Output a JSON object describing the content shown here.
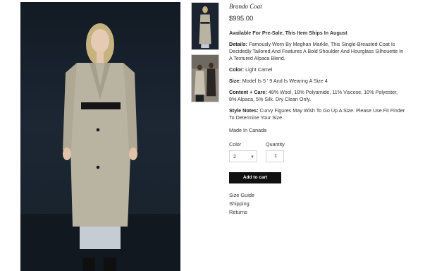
{
  "product": {
    "name": "Brando Coat",
    "price": "$995.00",
    "availability": "Available For Pre-Sale, This Item Ships In August",
    "details_label": "Details:",
    "details": "Famously Worn By Meghan Markle, This Single-Breasted Coat Is Decidedly Tailored And Features A Bold Shoulder And Hourglass Silhouette In A Textured Alpaca Blend.",
    "color_label": "Color:",
    "color": "Light Camel",
    "size_label": "Size:",
    "size": "Model Is 5 ' 9 And Is Wearing A Size 4",
    "care_label": "Content + Care:",
    "care": "48% Wool, 18% Polyamide, 11% Viscose, 10% Polyester, 8% Alpaca, 5% Silk. Dry Clean Only.",
    "style_label": "Style Notes:",
    "style": "Curvy Figures May Wish To Go Up A Size. Please Use Fit Finder To Determine Your Size.",
    "made_in": "Made In Canada"
  },
  "options": {
    "color_label": "Color",
    "color_value": "2",
    "quantity_label": "Quantity",
    "quantity_value": "1"
  },
  "cart": {
    "add_label": "Add to cart"
  },
  "links": {
    "size_guide": "Size Guide",
    "shipping": "Shipping",
    "returns": "Returns"
  },
  "colors": {
    "coat": "#b9b3a2",
    "background": "#1b2430",
    "button": "#111111"
  }
}
